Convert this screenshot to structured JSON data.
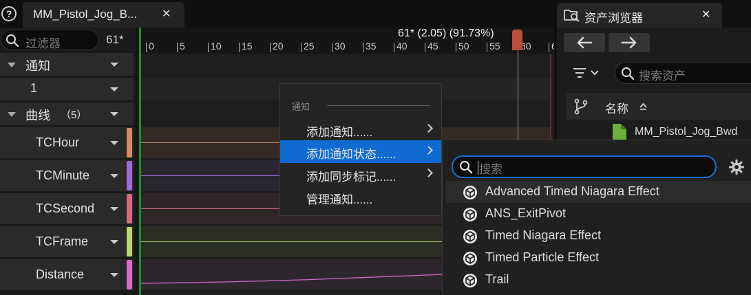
{
  "top_tab": {
    "label": "MM_Pistol_Jog_B...",
    "close": "✕",
    "help": "?"
  },
  "left_panel": {
    "filter_placeholder": "过滤器",
    "frame_count": "61*",
    "rows": [
      {
        "label": "通知",
        "type": "section"
      },
      {
        "label": "1",
        "type": "track"
      },
      {
        "label": "曲线",
        "count": "（5）",
        "type": "section"
      },
      {
        "label": "TCHour",
        "type": "curve",
        "color": "#d98c6a"
      },
      {
        "label": "TCMinute",
        "type": "curve",
        "color": "#a36ad9"
      },
      {
        "label": "TCSecond",
        "type": "curve",
        "color": "#d96a7a"
      },
      {
        "label": "TCFrame",
        "type": "curve",
        "color": "#b8d96a"
      },
      {
        "label": "Distance",
        "type": "curve",
        "color": "#d96ac8"
      }
    ]
  },
  "timeline": {
    "playhead_label": "61* (2.05) (91.73%)",
    "ticks": [
      "0",
      "5",
      "10",
      "15",
      "20",
      "25",
      "30",
      "35",
      "40",
      "45",
      "50",
      "55",
      "60",
      "6"
    ]
  },
  "asset_browser": {
    "title": "资产浏览器",
    "close": "✕",
    "search_placeholder": "搜索资产",
    "column_name": "名称",
    "asset_name": "MM_Pistol_Jog_Bwd"
  },
  "context_menu": {
    "section": "通知",
    "items": [
      {
        "label": "添加通知......",
        "has_submenu": true,
        "active": false
      },
      {
        "label": "添加通知状态......",
        "has_submenu": true,
        "active": true
      },
      {
        "label": "添加同步标记......",
        "has_submenu": true,
        "active": false
      },
      {
        "label": "管理通知......",
        "has_submenu": false,
        "active": false
      }
    ]
  },
  "submenu": {
    "search_placeholder": "搜索",
    "items": [
      {
        "label": "Advanced Timed Niagara Effect",
        "highlighted": true
      },
      {
        "label": "ANS_ExitPivot",
        "highlighted": false
      },
      {
        "label": "Timed Niagara Effect",
        "highlighted": false
      },
      {
        "label": "Timed Particle Effect",
        "highlighted": false
      },
      {
        "label": "Trail",
        "highlighted": false
      }
    ]
  },
  "colors": {
    "accent": "#0f6ad1",
    "playhead": "#b94c3a",
    "start_marker": "#1e8f2a"
  }
}
